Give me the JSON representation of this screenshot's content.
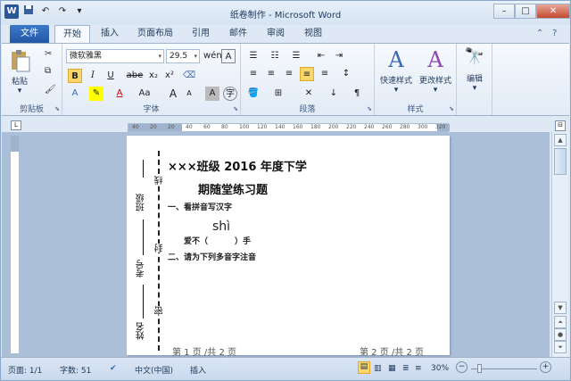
{
  "window": {
    "title": "纸卷制作 - Microsoft Word"
  },
  "qat": {
    "word_icon": "W",
    "undo": "↶",
    "redo": "↷",
    "customize": "▾"
  },
  "tabs": {
    "file": "文件",
    "home": "开始",
    "insert": "插入",
    "layout": "页面布局",
    "references": "引用",
    "mailings": "邮件",
    "review": "审阅",
    "view": "视图"
  },
  "ribbon": {
    "clipboard": {
      "label": "剪贴板",
      "paste": "粘贴"
    },
    "font": {
      "label": "字体",
      "name": "微软雅黑",
      "size": "29.5",
      "bold": "B",
      "italic": "I",
      "underline": "U",
      "strike": "abe",
      "sub": "x₂",
      "sup": "x²",
      "aa": "Aa",
      "grow": "A",
      "shrink": "A"
    },
    "paragraph": {
      "label": "段落"
    },
    "styles": {
      "label": "样式",
      "quick": "快速样式",
      "change": "更改样式"
    },
    "editing": {
      "label": "编辑"
    }
  },
  "ruler": {
    "ticks": [
      "40",
      "20",
      "20",
      "40",
      "60",
      "80",
      "100",
      "120",
      "140",
      "160",
      "180",
      "200",
      "220",
      "240",
      "260",
      "280",
      "300",
      "320"
    ]
  },
  "document": {
    "line1": "×××班级 2016 年度下学",
    "line2": "期随堂练习题",
    "q1": "一、看拼音写汉字",
    "pinyin": "shì",
    "q1_item_pre": "爱不（",
    "q1_item_post": "）手",
    "q2": "二、请为下列多音字注音",
    "side_class": "班级",
    "side_exam": "考号",
    "side_name": "姓名",
    "side_line": "线",
    "side_seal": "封",
    "side_mi": "密"
  },
  "footer": {
    "page1": "第 1 页 /共 2 页",
    "page2": "第 2 页 /共 2 页"
  },
  "status": {
    "page": "页面: 1/1",
    "words": "字数: 51",
    "lang": "中文(中国)",
    "mode": "插入",
    "zoom": "30%",
    "minus": "−",
    "plus": "+"
  }
}
